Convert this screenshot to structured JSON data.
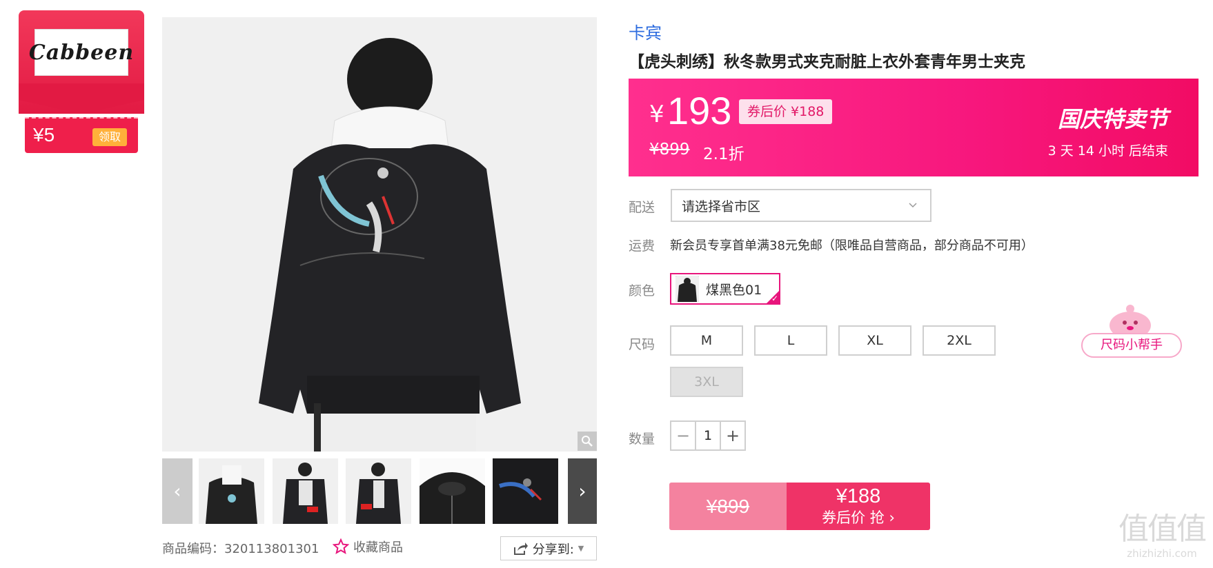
{
  "brand_card": {
    "logo_text": "Cabbeen",
    "coupon_value": "¥5",
    "claim_label": "领取"
  },
  "product": {
    "brand_link": "卡宾",
    "title": "【虎头刺绣】秋冬款男式夹克耐脏上衣外套青年男士夹克",
    "sku_line": "商品编码：320113801301",
    "favorite_label": "收藏商品",
    "share_label": "分享到:"
  },
  "price_banner": {
    "currency": "¥",
    "price": "193",
    "coupon_price": "券后价 ¥188",
    "original_price": "¥899",
    "discount": "2.1折",
    "festival": "国庆特卖节",
    "countdown": "3  天 14 小时 后结束"
  },
  "options": {
    "delivery_label": "配送",
    "delivery_placeholder": "请选择省市区",
    "shipping_label": "运费",
    "shipping_text": "新会员专享首单满38元免邮（限唯品自营商品，部分商品不可用）",
    "color_label": "颜色",
    "color_value": "煤黑色01",
    "size_label": "尺码",
    "sizes": [
      "M",
      "L",
      "XL",
      "2XL",
      "3XL"
    ],
    "size_helper": "尺码小帮手",
    "quantity_label": "数量",
    "quantity": "1",
    "minus": "−",
    "plus": "+"
  },
  "buy": {
    "original_price": "¥899",
    "price": "¥188",
    "label": "券后价 抢 ›"
  },
  "watermark": {
    "line1": "值值值",
    "line2": "zhizhizhi.com"
  },
  "colors": {
    "banner_pink": "#f7177d",
    "accent": "#e8157c",
    "link_blue": "#2d6cdf"
  }
}
